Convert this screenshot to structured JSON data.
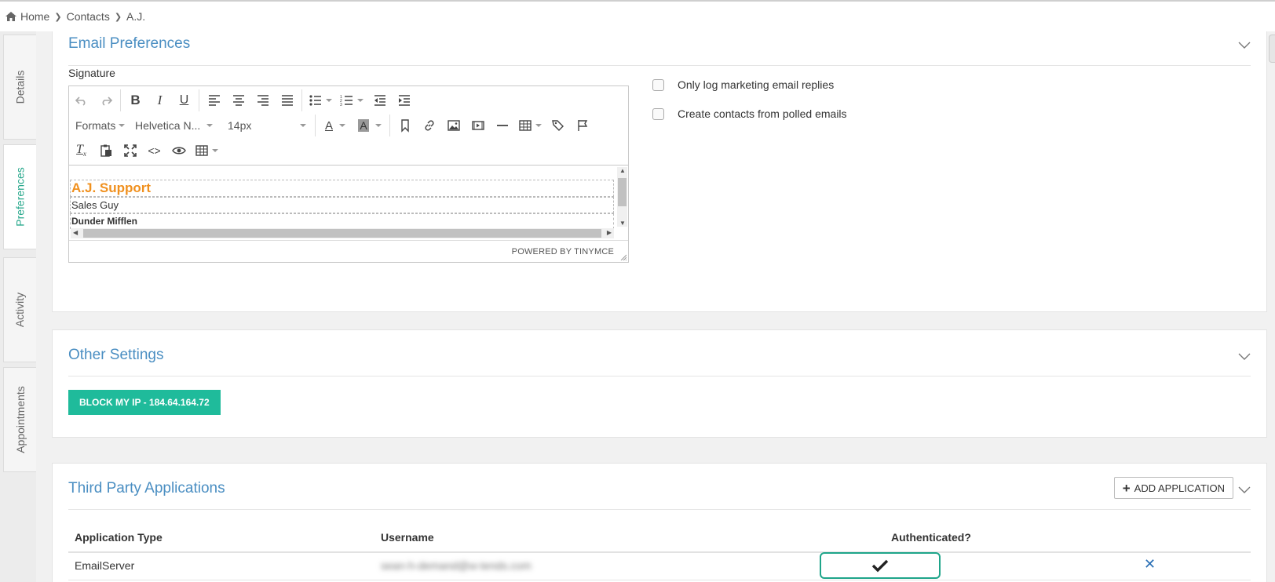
{
  "breadcrumb": {
    "items": [
      "Home",
      "Contacts",
      "A.J."
    ]
  },
  "sidetabs": [
    {
      "label": "Details",
      "active": false
    },
    {
      "label": "Preferences",
      "active": true
    },
    {
      "label": "Activity",
      "active": false
    },
    {
      "label": "Appointments",
      "active": false
    }
  ],
  "email_prefs": {
    "title": "Email Preferences",
    "signature_label": "Signature",
    "editor": {
      "formats_label": "Formats",
      "font_label": "Helvetica N...",
      "size_label": "14px",
      "status_text": "POWERED BY TINYMCE",
      "signature_lines": [
        {
          "text": "A.J. Support",
          "color": "#f0901e"
        },
        {
          "text": "Sales Guy"
        },
        {
          "text": "Dunder Mifflen"
        }
      ]
    },
    "options": [
      {
        "label": "Only log marketing email replies",
        "checked": false
      },
      {
        "label": "Create contacts from polled emails",
        "checked": false
      }
    ]
  },
  "other_settings": {
    "title": "Other Settings",
    "block_button_label": "BLOCK MY IP - 184.64.164.72"
  },
  "third_party": {
    "title": "Third Party Applications",
    "add_button_label": "ADD APPLICATION",
    "columns": [
      "Application Type",
      "Username",
      "Authenticated?"
    ],
    "rows": [
      {
        "type": "EmailServer",
        "username": "sean-h-demand@w-tends.com",
        "authenticated": true
      }
    ]
  },
  "colors": {
    "accent": "#1fbb9b",
    "title_blue": "#4a8ec2",
    "signature_orange": "#f0901e"
  },
  "icons": [
    "home-icon",
    "chevron-right-icon",
    "chevron-down-icon",
    "checkmark-icon",
    "close-icon",
    "plus-icon"
  ]
}
